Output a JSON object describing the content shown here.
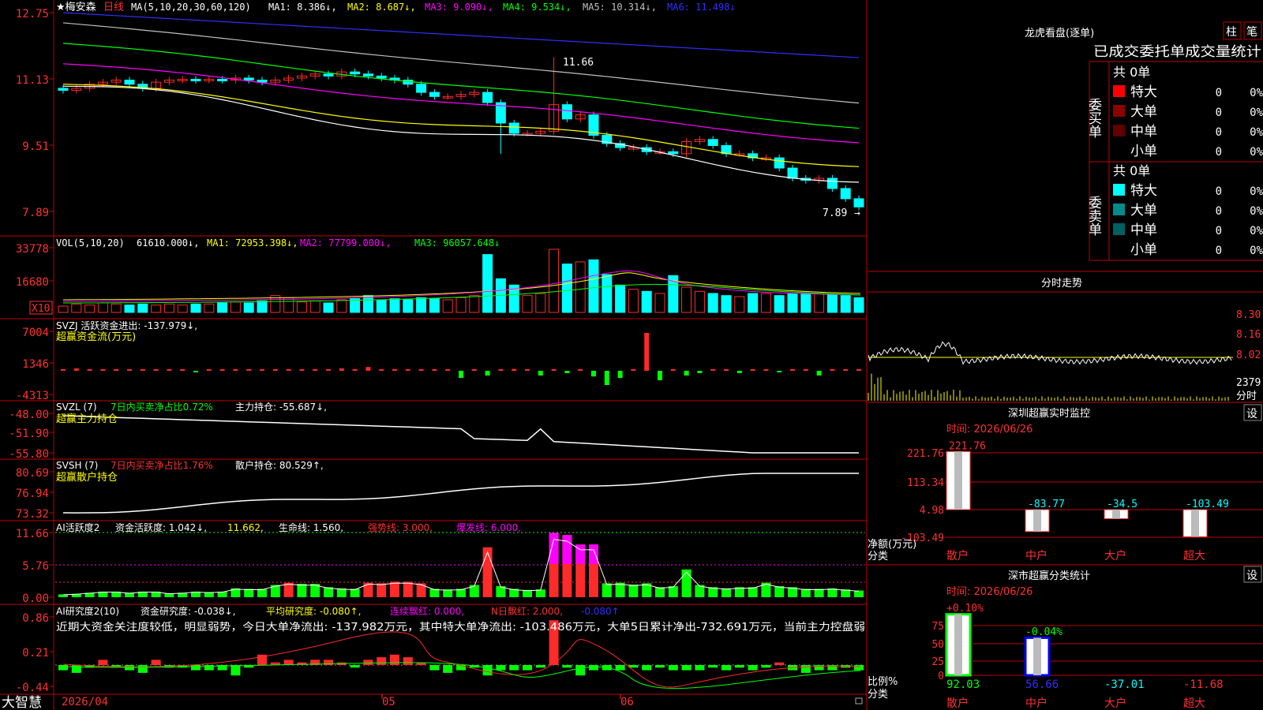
{
  "colors": {
    "up": "#ff2a2a",
    "down": "#00ffff",
    "frame": "#c00000",
    "ma1": "#ffffff",
    "ma2": "#ffff00",
    "ma3": "#ff00ff",
    "ma4": "#00ff00",
    "ma5": "#c0c0c0",
    "ma6": "#3030ff",
    "green": "#00ff00"
  },
  "kline": {
    "title": "★梅安森",
    "period": "日线",
    "ma_label": "MA(5,10,20,30,60,120)",
    "ma1": "MA1: 8.386↓,",
    "ma2": "MA2: 8.687↓,",
    "ma3": "MA3: 9.090↓,",
    "ma4": "MA4: 9.534↓,",
    "ma5": "MA5: 10.314↓,",
    "ma6": "MA6: 11.498↓",
    "y_ticks": [
      "12.75",
      "11.13",
      "9.51",
      "7.89"
    ],
    "high_label": "11.66",
    "low_label": "7.89"
  },
  "vol": {
    "title": "VOL(5,10,20)",
    "value": "61610.000↓,",
    "ma1": "MA1: 72953.398↓,",
    "ma2": "MA2: 77799.000↓,",
    "ma3": "MA3: 96057.648↓",
    "y_ticks": [
      "33778",
      "16680"
    ],
    "unit": "X10"
  },
  "svzj": {
    "line1": "SVZJ  活跃资金进出: -137.979↓,",
    "line2": "超赢资金流(万元)",
    "y_ticks": [
      "7004",
      "1346",
      "-4313"
    ]
  },
  "svzl": {
    "name": "SVZL (7)",
    "ratio": "7日内买卖净占比0.72%",
    "hold": "主力持仓: -55.687↓,",
    "sub": "超赢主力持仓",
    "y_ticks": [
      "-48.00",
      "-51.90",
      "-55.80"
    ]
  },
  "svsh": {
    "name": "SVSH (7)",
    "ratio": "7日内买卖净占比1.76%",
    "hold": "散户持仓: 80.529↑,",
    "sub": "超赢散户持仓",
    "y_ticks": [
      "80.69",
      "76.94",
      "73.32"
    ]
  },
  "ai1": {
    "name": "AI活跃度2",
    "f1": "资金活跃度: 1.042↓,",
    "f2": "11.662,",
    "f3": "生命线: 1.560,",
    "f4": "强势线: 3.000,",
    "f5": "爆发线: 6.000,",
    "y_ticks": [
      "11.66",
      "5.76",
      "0.00"
    ]
  },
  "ai2": {
    "name": "AI研究度2(10)",
    "f1": "资金研究度: -0.038↓,",
    "f2": "平均研究度: -0.080↑,",
    "f3": "连续飘红: 0.000,",
    "f4": "N日飘红: 2.000,",
    "f5": "-0.080↑",
    "comment": "近期大资金关注度较低，明显弱势，今日大单净流出: -137.982万元，其中特大单净流出: -103.486万元，大单5日累计净出-732.691万元，当前主力控盘弱",
    "y_ticks": [
      "0.86",
      "0.21",
      "-0.44"
    ]
  },
  "xaxis": {
    "brand": "大智慧",
    "labels": [
      "2026/04",
      "05",
      "06"
    ]
  },
  "longhu": {
    "title": "龙虎看盘(逐单)",
    "btn1": "柱",
    "btn2": "笔",
    "tabs": "已成交委托单成交量统计",
    "buy": {
      "side": "委买单",
      "total": "共 0单",
      "rows": [
        {
          "name": "特大",
          "count": "0",
          "pct": "0%"
        },
        {
          "name": "大单",
          "count": "0",
          "pct": "0%"
        },
        {
          "name": "中单",
          "count": "0",
          "pct": "0%"
        },
        {
          "name": "小单",
          "count": "0",
          "pct": "0%"
        }
      ]
    },
    "sell": {
      "side": "委卖单",
      "total": "共 0单",
      "rows": [
        {
          "name": "特大",
          "count": "0",
          "pct": "0%"
        },
        {
          "name": "大单",
          "count": "0",
          "pct": "0%"
        },
        {
          "name": "中单",
          "count": "0",
          "pct": "0%"
        },
        {
          "name": "小单",
          "count": "0",
          "pct": "0%"
        }
      ]
    }
  },
  "fenshi": {
    "title": "分时走势",
    "y_ticks": [
      "8.30",
      "8.16",
      "8.02"
    ],
    "vol": "2379",
    "vol_label": "分时"
  },
  "monitor": {
    "title": "深圳超赢实时监控",
    "btn": "设",
    "time": "时间: 2026/06/26",
    "y_ticks": [
      "221.76",
      "113.34",
      "4.98",
      "-103.49"
    ],
    "unit": "净额(万元)",
    "cat_label": "分类",
    "bars": [
      {
        "name": "散户",
        "value": "221.76"
      },
      {
        "name": "中户",
        "value": "-83.77"
      },
      {
        "name": "大户",
        "value": "-34.5"
      },
      {
        "name": "超大",
        "value": "-103.49"
      }
    ]
  },
  "classify": {
    "title": "深市超赢分类统计",
    "btn": "设",
    "time": "时间: 2026/06/26",
    "y_ticks": [
      "75",
      "50",
      "25",
      "0"
    ],
    "unit": "比例%",
    "cat_label": "分类",
    "top_vals": [
      "+0.10%",
      "-0.04%"
    ],
    "bars": [
      {
        "name": "散户",
        "value": "92.03"
      },
      {
        "name": "中户",
        "value": "56.66"
      },
      {
        "name": "大户",
        "value": "-37.01"
      },
      {
        "name": "超大",
        "value": "-11.68"
      }
    ]
  }
}
